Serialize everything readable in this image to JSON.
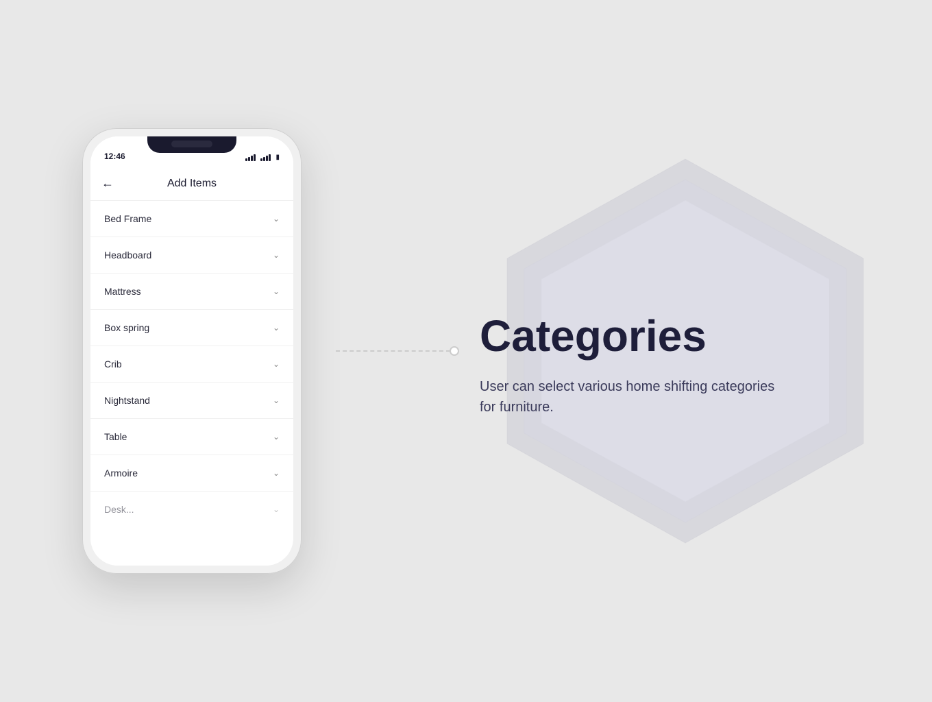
{
  "background": "#e8e8e8",
  "phone": {
    "status_bar": {
      "time": "12:46",
      "icons": [
        "signal",
        "wifi",
        "battery"
      ]
    },
    "header": {
      "title": "Add Items",
      "back_label": "←"
    },
    "items": [
      {
        "label": "Bed Frame"
      },
      {
        "label": "Headboard"
      },
      {
        "label": "Mattress"
      },
      {
        "label": "Box spring"
      },
      {
        "label": "Crib"
      },
      {
        "label": "Nightstand"
      },
      {
        "label": "Table"
      },
      {
        "label": "Armoire"
      },
      {
        "label": "Desk..."
      }
    ]
  },
  "right_panel": {
    "title": "Categories",
    "description": "User can select various home shifting categories for furniture."
  }
}
